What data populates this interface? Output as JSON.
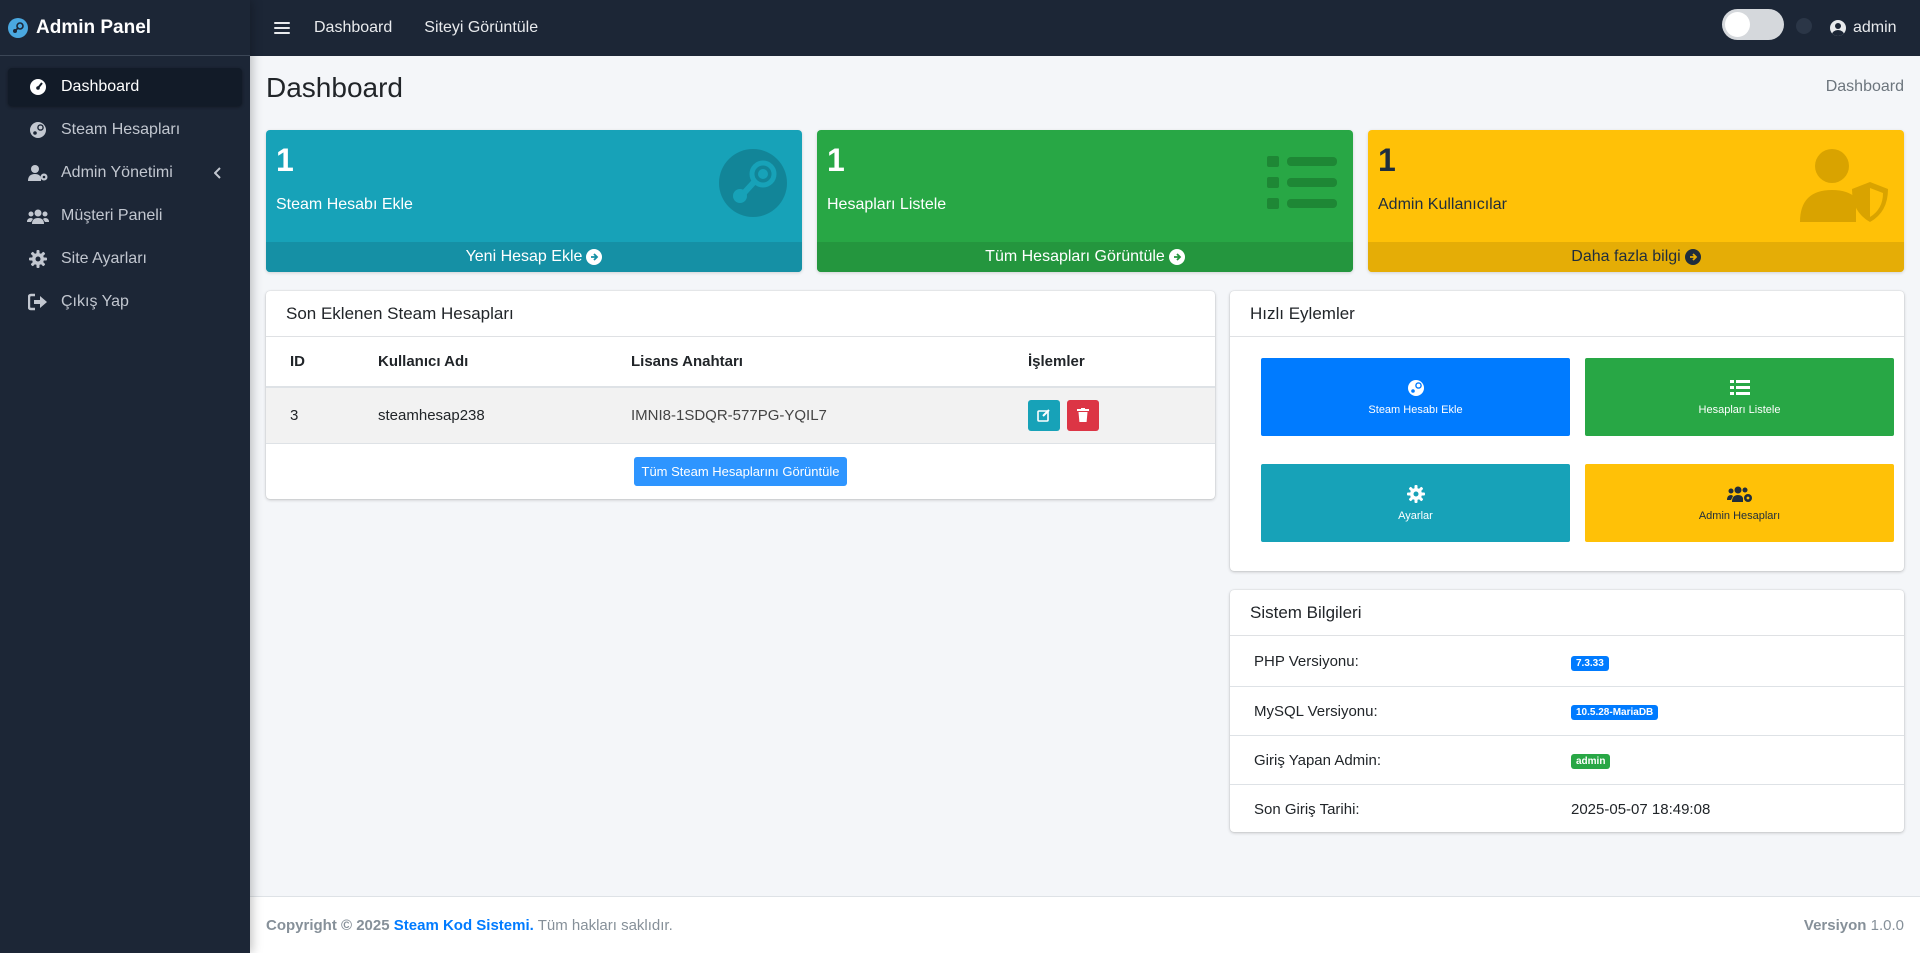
{
  "brand": {
    "title": "Admin Panel"
  },
  "sidebar": {
    "items": [
      {
        "label": "Dashboard",
        "icon": "gauge-icon",
        "active": true
      },
      {
        "label": "Steam Hesapları",
        "icon": "steam-icon"
      },
      {
        "label": "Admin Yönetimi",
        "icon": "user-cog-icon",
        "has_children": true
      },
      {
        "label": "Müşteri Paneli",
        "icon": "users-icon"
      },
      {
        "label": "Site Ayarları",
        "icon": "gear-icon"
      },
      {
        "label": "Çıkış Yap",
        "icon": "sign-out-icon"
      }
    ]
  },
  "topbar": {
    "links": [
      "Dashboard",
      "Siteyi Görüntüle"
    ],
    "user": "admin"
  },
  "page": {
    "title": "Dashboard",
    "breadcrumb": "Dashboard"
  },
  "boxes": [
    {
      "number": "1",
      "label": "Steam Hesabı Ekle",
      "footer": "Yeni Hesap Ekle",
      "color": "#17a2b8",
      "foot_color": "#1590a5",
      "icon": "steam-icon"
    },
    {
      "number": "1",
      "label": "Hesapları Listele",
      "footer": "Tüm Hesapları Görüntüle",
      "color": "#28a745",
      "foot_color": "#24963e",
      "icon": "list-icon"
    },
    {
      "number": "1",
      "label": "Admin Kullanıcılar",
      "footer": "Daha fazla bilgi",
      "color": "#ffc107",
      "foot_color": "#e5ad06",
      "icon": "user-shield-icon"
    }
  ],
  "recent": {
    "title": "Son Eklenen Steam Hesapları",
    "columns": [
      "ID",
      "Kullanıcı Adı",
      "Lisans Anahtarı",
      "İşlemler"
    ],
    "rows": [
      {
        "id": "3",
        "username": "steamhesap238",
        "license": "IMNI8-1SDQR-577PG-YQIL7"
      }
    ],
    "view_all": "Tüm Steam Hesaplarını Görüntüle"
  },
  "quick": {
    "title": "Hızlı Eylemler",
    "actions": [
      {
        "label": "Steam Hesabı Ekle",
        "color": "#007bff",
        "icon": "steam-icon"
      },
      {
        "label": "Hesapları Listele",
        "color": "#28a745",
        "icon": "list-icon"
      },
      {
        "label": "Ayarlar",
        "color": "#17a2b8",
        "icon": "gear-icon"
      },
      {
        "label": "Admin Hesapları",
        "color": "#ffc107",
        "icon": "users-cog-icon"
      }
    ]
  },
  "system": {
    "title": "Sistem Bilgileri",
    "rows": [
      {
        "label": "PHP Versiyonu:",
        "value": "7.3.33",
        "badge_color": "#007bff"
      },
      {
        "label": "MySQL Versiyonu:",
        "value": "10.5.28-MariaDB",
        "badge_color": "#007bff"
      },
      {
        "label": "Giriş Yapan Admin:",
        "value": "admin",
        "badge_color": "#28a745"
      },
      {
        "label": "Son Giriş Tarihi:",
        "value": "2025-05-07 18:49:08"
      }
    ]
  },
  "footer": {
    "copyright": "Copyright © 2025",
    "company": "Steam Kod Sistemi.",
    "rights": "Tüm hakları saklıdır.",
    "version_label": "Versiyon",
    "version": "1.0.0"
  }
}
